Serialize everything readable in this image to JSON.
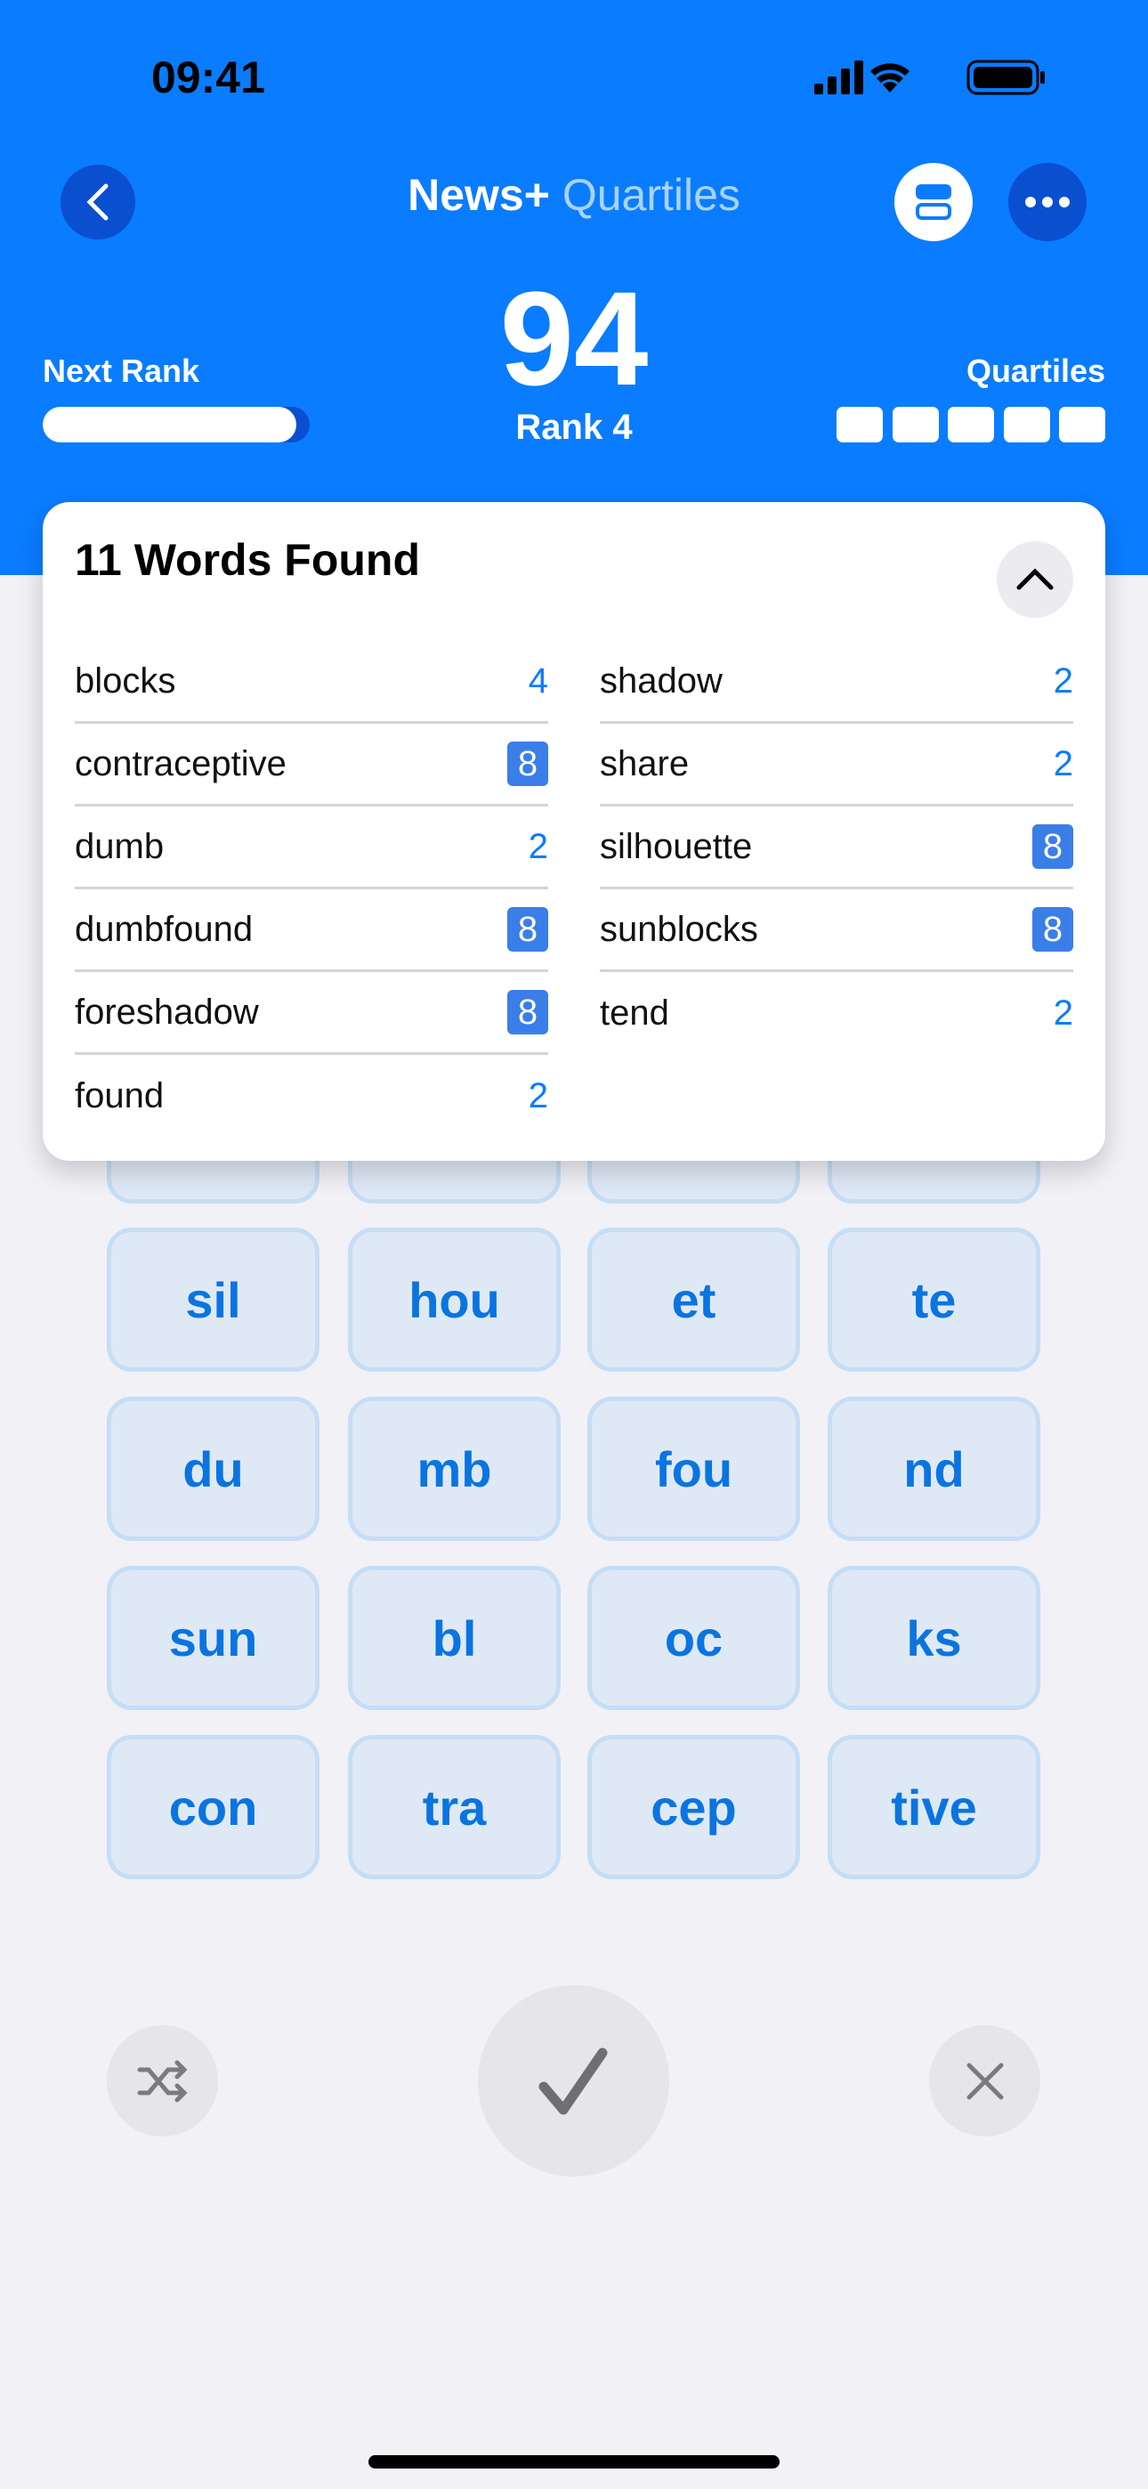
{
  "status": {
    "time": "09:41"
  },
  "nav": {
    "brand": "News+",
    "game": "Quartiles"
  },
  "score": {
    "points": "94",
    "rank": "Rank 4",
    "next_rank_label": "Next Rank",
    "next_rank_progress": 0.95,
    "quartiles_label": "Quartiles",
    "quartiles_found": 0,
    "quartiles_total": 5
  },
  "words": {
    "title": "11 Words Found",
    "left": [
      {
        "word": "blocks",
        "points": "4",
        "quartile": false
      },
      {
        "word": "contraceptive",
        "points": "8",
        "quartile": true
      },
      {
        "word": "dumb",
        "points": "2",
        "quartile": false
      },
      {
        "word": "dumbfound",
        "points": "8",
        "quartile": true
      },
      {
        "word": "foreshadow",
        "points": "8",
        "quartile": true
      },
      {
        "word": "found",
        "points": "2",
        "quartile": false
      }
    ],
    "right": [
      {
        "word": "shadow",
        "points": "2",
        "quartile": false
      },
      {
        "word": "share",
        "points": "2",
        "quartile": false
      },
      {
        "word": "silhouette",
        "points": "8",
        "quartile": true
      },
      {
        "word": "sunblocks",
        "points": "8",
        "quartile": true
      },
      {
        "word": "tend",
        "points": "2",
        "quartile": false
      }
    ]
  },
  "tiles": [
    [
      "sil",
      "hou",
      "et",
      "te"
    ],
    [
      "du",
      "mb",
      "fou",
      "nd"
    ],
    [
      "sun",
      "bl",
      "oc",
      "ks"
    ],
    [
      "con",
      "tra",
      "cep",
      "tive"
    ]
  ],
  "colors": {
    "accent": "#0a7cff",
    "tile_text": "#0a74e0",
    "quartile_badge": "#3a7ee8"
  }
}
